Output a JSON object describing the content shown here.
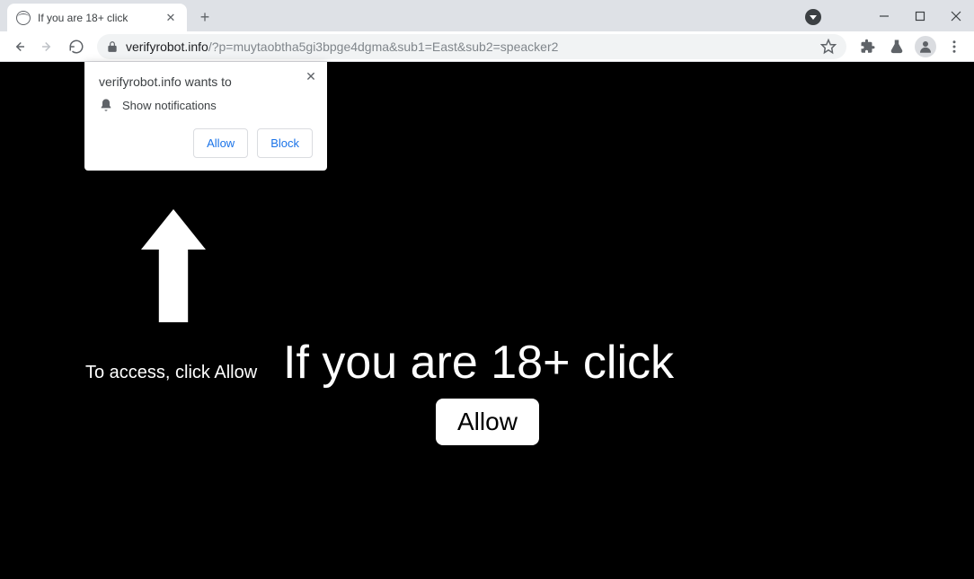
{
  "browser": {
    "tab_title": "If you are 18+ click",
    "url_domain": "verifyrobot.info",
    "url_path": "/?p=muytaobtha5gi3bpge4dgma&sub1=East&sub2=speacker2"
  },
  "notification": {
    "title": "verifyrobot.info wants to",
    "prompt": "Show notifications",
    "allow_label": "Allow",
    "block_label": "Block"
  },
  "page": {
    "access_text": "To access, click Allow",
    "headline": "If you are 18+ click",
    "allow_button": "Allow"
  }
}
